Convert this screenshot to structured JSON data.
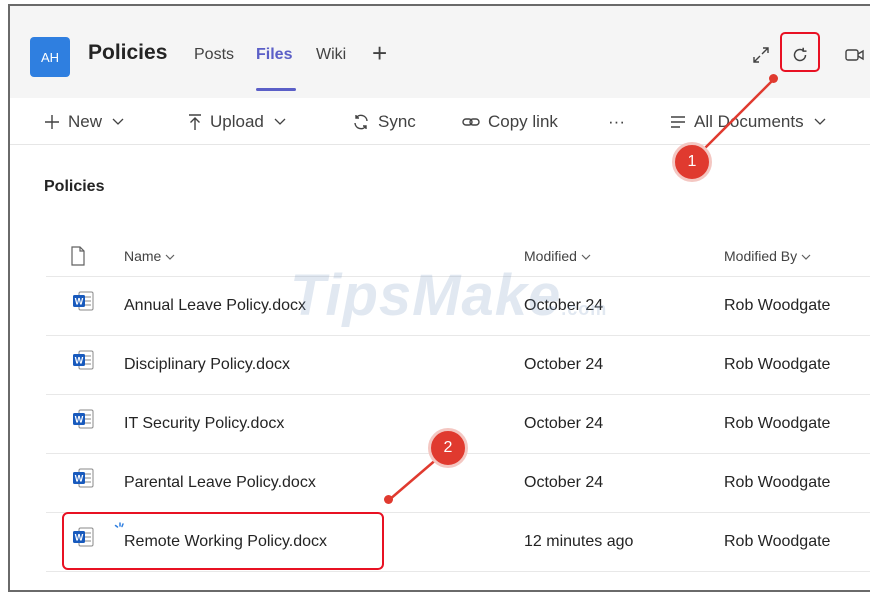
{
  "header": {
    "avatar_initials": "AH",
    "team_title": "Policies",
    "tabs": [
      {
        "label": "Posts"
      },
      {
        "label": "Files",
        "active": true
      },
      {
        "label": "Wiki"
      }
    ],
    "add_tab_glyph": "+",
    "icons": [
      "expand-icon",
      "refresh-icon",
      "meet-icon"
    ]
  },
  "toolbar": {
    "new_label": "New",
    "upload_label": "Upload",
    "sync_label": "Sync",
    "copy_link_label": "Copy link",
    "more_label": "···",
    "view_label": "All Documents"
  },
  "library": {
    "title": "Policies",
    "columns": {
      "name": "Name",
      "modified": "Modified",
      "modified_by": "Modified By"
    },
    "files": [
      {
        "name": "Annual Leave Policy.docx",
        "modified": "October 24",
        "modified_by": "Rob Woodgate"
      },
      {
        "name": "Disciplinary Policy.docx",
        "modified": "October 24",
        "modified_by": "Rob Woodgate"
      },
      {
        "name": "IT Security Policy.docx",
        "modified": "October 24",
        "modified_by": "Rob Woodgate"
      },
      {
        "name": "Parental Leave Policy.docx",
        "modified": "October 24",
        "modified_by": "Rob Woodgate"
      },
      {
        "name": "Remote Working Policy.docx",
        "modified": "12 minutes ago",
        "modified_by": "Rob Woodgate"
      }
    ]
  },
  "annotations": {
    "marker1": "1",
    "marker2": "2"
  },
  "watermark": {
    "text": "TipsMake",
    "suffix": ".com"
  },
  "colors": {
    "accent": "#5b5fc7",
    "avatar": "#2f7fe0",
    "annotation": "#e03a2f",
    "word": "#185abd"
  }
}
